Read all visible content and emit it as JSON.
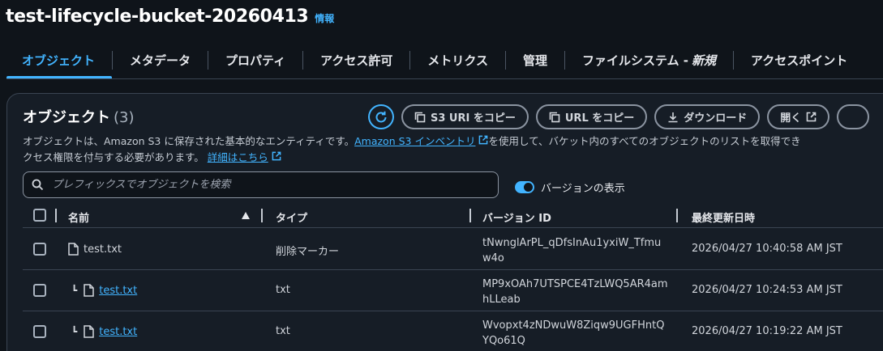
{
  "header": {
    "title": "test-lifecycle-bucket-20260413",
    "info": "情報"
  },
  "tabs": [
    {
      "label": "オブジェクト",
      "active": true
    },
    {
      "label": "メタデータ"
    },
    {
      "label": "プロパティ"
    },
    {
      "label": "アクセス許可"
    },
    {
      "label": "メトリクス"
    },
    {
      "label": "管理"
    },
    {
      "label": "ファイルシステム - ",
      "suffix": "新規"
    },
    {
      "label": "アクセスポイント"
    }
  ],
  "panel": {
    "title": "オブジェクト",
    "count": "(3)",
    "buttons": {
      "copy_s3_uri": "S3 URI をコピー",
      "copy_url": "URL をコピー",
      "download": "ダウンロード",
      "open": "開く"
    },
    "description": {
      "part1": "オブジェクトは、Amazon S3 に保存された基本的なエンティティです。",
      "inventory_link": "Amazon S3 インベントリ",
      "part2": "を使用して、バケット内のすべてのオブジェクトのリストを取得でき",
      "line2": "クセス権限を付与する必要があります。",
      "learn_more": "詳細はこちら"
    },
    "search": {
      "placeholder": "プレフィックスでオブジェクトを検索"
    },
    "toggle": {
      "label": "バージョンの表示",
      "on": true
    }
  },
  "table": {
    "columns": {
      "name": "名前",
      "type": "タイプ",
      "version": "バージョン ID",
      "modified": "最終更新日時"
    },
    "rows": [
      {
        "name": "test.txt",
        "type": "削除マーカー",
        "version": "tNwnglArPL_qDfsInAu1yxiW_Tfmuw4o",
        "modified": "2026/04/27 10:40:58 AM JST",
        "link": false,
        "child": false
      },
      {
        "name": "test.txt",
        "type": "txt",
        "version": "MP9xOAh7UTSPCE4TzLWQ5AR4amhLLeab",
        "modified": "2026/04/27 10:24:53 AM JST",
        "link": true,
        "child": true
      },
      {
        "name": "test.txt",
        "type": "txt",
        "version": "Wvopxt4zNDwuW8Ziqw9UGFHntQYQo61Q",
        "modified": "2026/04/27 10:19:22 AM JST",
        "link": true,
        "child": true
      }
    ]
  },
  "colors": {
    "accent": "#42b4ff",
    "background": "#0f141a",
    "panel": "#161d26",
    "border": "#3a4452"
  }
}
